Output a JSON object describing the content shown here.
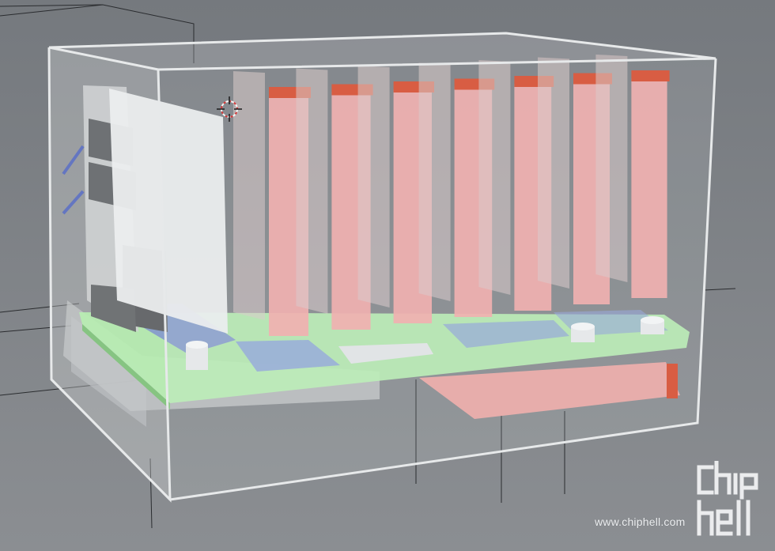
{
  "viewport": {
    "background_color": "#7f8286",
    "components": {
      "enclosure": "transparent-case",
      "motherboard": "green-pcb",
      "expansion_cards": 7,
      "cpu_coolers": "blue-heatsinks",
      "bracket_tabs_color": "#d6492c",
      "card_color": "#f2a8a8",
      "pcb_color": "#b4f0b0",
      "heatsink_color": "#7f92d8"
    },
    "cursor_icon": "3d-cursor-icon"
  },
  "watermark": {
    "logo_text": "chip hell",
    "url": "www.chiphell.com"
  }
}
